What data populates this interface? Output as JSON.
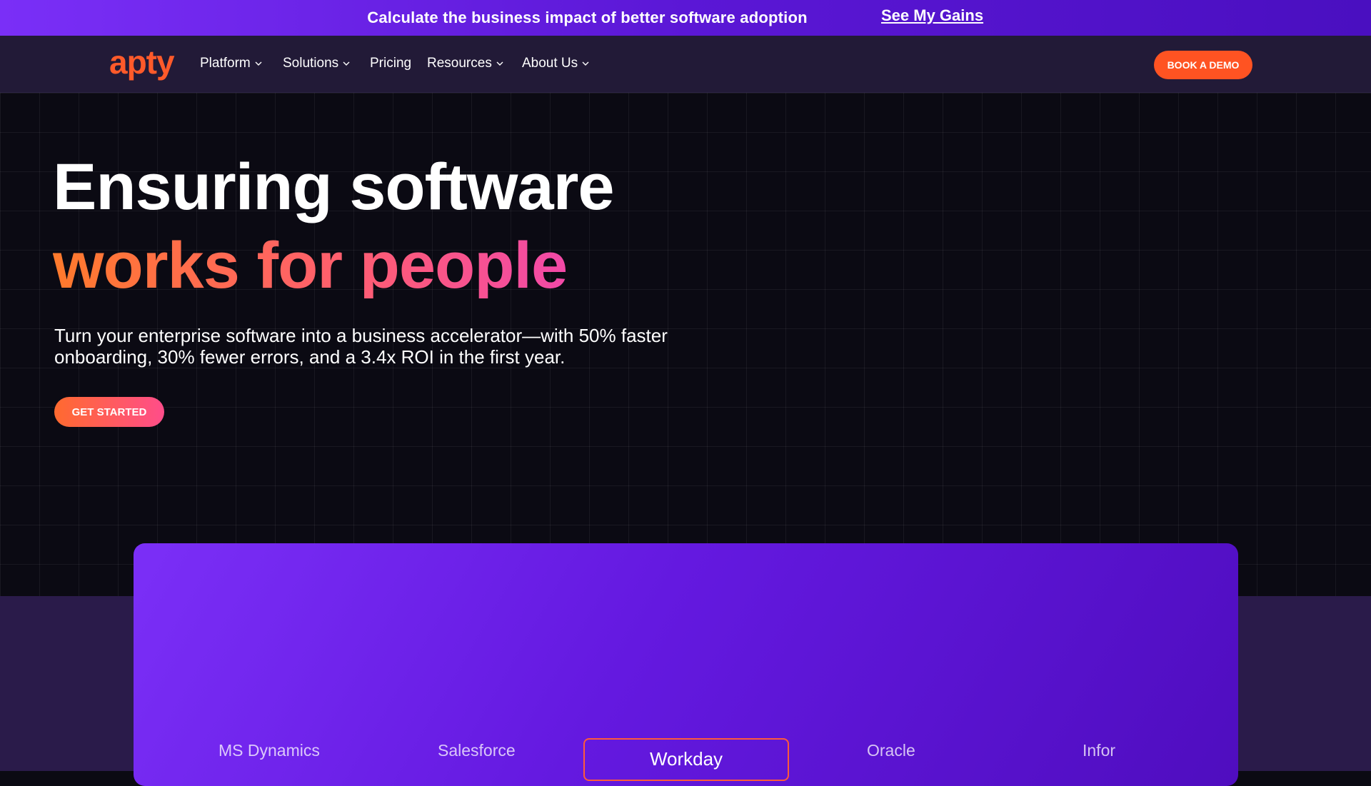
{
  "announcement": {
    "text": "Calculate the business impact of better software adoption",
    "link_label": "See My Gains"
  },
  "nav": {
    "logo_text": "apty",
    "items": [
      {
        "label": "Platform",
        "has_dropdown": true
      },
      {
        "label": "Solutions",
        "has_dropdown": true
      },
      {
        "label": "Pricing",
        "has_dropdown": false
      },
      {
        "label": "Resources",
        "has_dropdown": true
      },
      {
        "label": "About Us",
        "has_dropdown": true
      }
    ],
    "cta_label": "BOOK A DEMO"
  },
  "hero": {
    "headline_line1": "Ensuring software",
    "headline_line2": "works for people",
    "subhead": "Turn your enterprise software into a business accelerator—with 50% faster onboarding, 30% fewer errors, and a 3.4x ROI in the first year.",
    "cta_label": "GET STARTED"
  },
  "platform_tabs": {
    "items": [
      "MS Dynamics",
      "Salesforce",
      "Workday",
      "Oracle",
      "Infor"
    ],
    "selected": "Workday"
  },
  "colors": {
    "brand_orange": "#ff5322",
    "announcement_purple": "#7a2ff7",
    "nav_background": "#221a37",
    "hero_background": "#0b0a13",
    "card_purple": "#6419e0",
    "headline_gradient_start": "#ff7a2c",
    "headline_gradient_end": "#f249a8"
  },
  "icons": {
    "dropdown": "chevron-down-icon"
  }
}
